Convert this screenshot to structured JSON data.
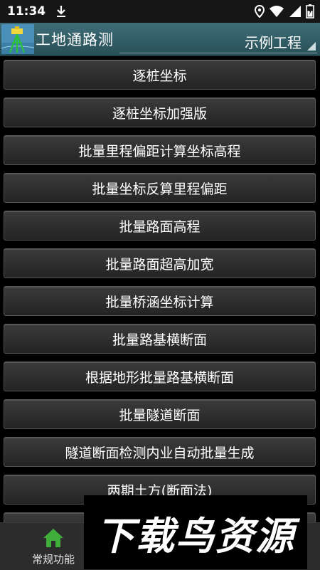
{
  "status_bar": {
    "time": "11:34"
  },
  "app_bar": {
    "title": "工地通路测",
    "project": "示例工程"
  },
  "menu": [
    {
      "label": "逐桩坐标"
    },
    {
      "label": "逐桩坐标加强版"
    },
    {
      "label": "批量里程偏距计算坐标高程"
    },
    {
      "label": "批量坐标反算里程偏距"
    },
    {
      "label": "批量路面高程"
    },
    {
      "label": "批量路面超高加宽"
    },
    {
      "label": "批量桥涵坐标计算"
    },
    {
      "label": "批量路基横断面"
    },
    {
      "label": "根据地形批量路基横断面"
    },
    {
      "label": "批量隧道断面"
    },
    {
      "label": "隧道断面检测内业自动批量生成"
    },
    {
      "label": "两期土方(断面法)"
    }
  ],
  "bottom_nav": {
    "tabs": [
      {
        "label": "常规功能",
        "icon": "home-icon",
        "color": "#3fae3a"
      }
    ]
  },
  "watermark": {
    "text": "下载鸟资源"
  },
  "colors": {
    "app_bar": "#3a6a74",
    "accent": "#3fae3a"
  }
}
